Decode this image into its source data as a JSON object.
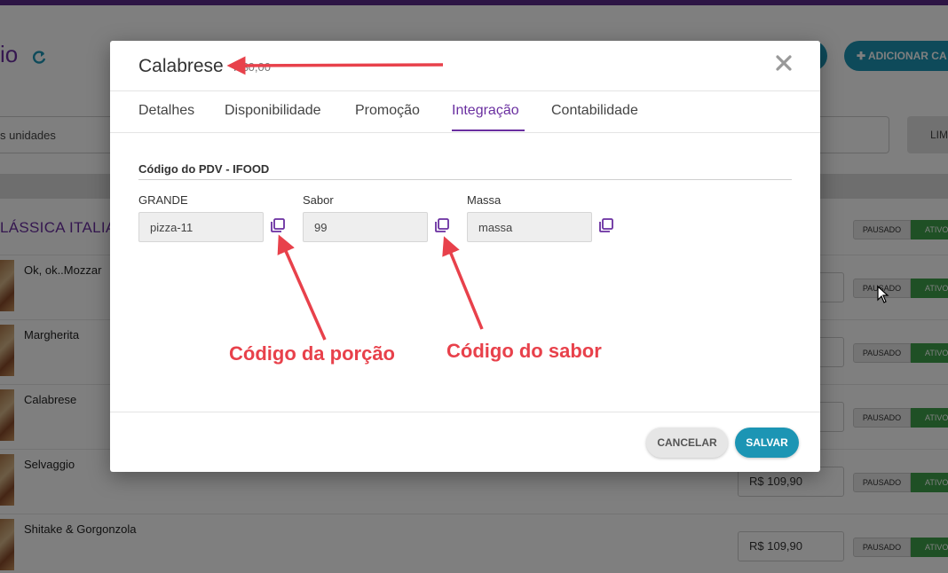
{
  "background": {
    "header_title": "io",
    "add_button": "ADICIONAR CA",
    "filter_text": "s unidades",
    "clear_button": "LIM",
    "category_title": "LÁSSICA ITALIA",
    "items": [
      {
        "name": "Ok, ok..Mozzar",
        "price": ""
      },
      {
        "name": "Margherita",
        "price": ""
      },
      {
        "name": "Calabrese",
        "price": ""
      },
      {
        "name": "Selvaggio",
        "price": "R$ 109,90"
      },
      {
        "name": "Shitake & Gorgonzola",
        "price": "R$ 109,90"
      }
    ],
    "toggle_paused": "PAUSADO",
    "toggle_active": "ATIVO"
  },
  "modal": {
    "title": "Calabrese",
    "title_price": "R$0,00",
    "tabs": [
      "Detalhes",
      "Disponibilidade",
      "Promoção",
      "Integração",
      "Contabilidade"
    ],
    "active_tab": "Integração",
    "section_title": "Código do PDV - IFOOD",
    "fields": [
      {
        "label": "GRANDE",
        "value": "pizza-11"
      },
      {
        "label": "Sabor",
        "value": "99"
      },
      {
        "label": "Massa",
        "value": "massa"
      }
    ],
    "cancel_label": "CANCELAR",
    "save_label": "SALVAR"
  },
  "annotations": {
    "portion_code": "Código da porção",
    "flavor_code": "Código do sabor"
  },
  "colors": {
    "brand_purple": "#6a2fa0",
    "accent_teal": "#1c95b4",
    "active_green": "#3fa14a",
    "annotation_red": "#e8414b"
  },
  "icons": {
    "close": "close-icon",
    "copy": "copy-icon",
    "refresh": "refresh-icon",
    "plus": "plus-icon"
  }
}
